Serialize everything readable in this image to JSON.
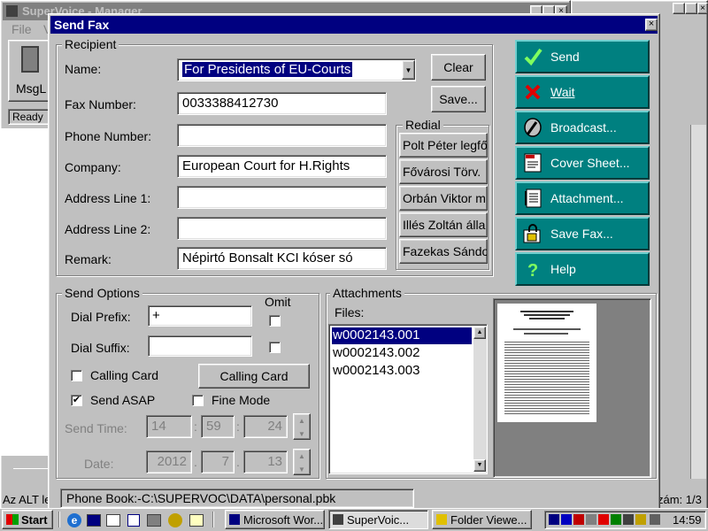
{
  "bg_window": {
    "title": "SuperVoice - Manager",
    "menu_file": "File",
    "menu_v": "V",
    "tool_label": "MsgL",
    "status_ready": "Ready",
    "status_alt": "Az ALT le",
    "page_indicator": "zám: 1/3"
  },
  "dialog": {
    "title": "Send Fax",
    "recipient_group": "Recipient",
    "labels": {
      "name": "Name:",
      "fax": "Fax Number:",
      "phone": "Phone Number:",
      "company": "Company:",
      "addr1": "Address Line 1:",
      "addr2": "Address Line 2:",
      "remark": "Remark:"
    },
    "values": {
      "name": "For Presidents of EU-Courts",
      "fax": "0033388412730",
      "phone": "",
      "company": "European Court for H.Rights",
      "addr1": "",
      "addr2": "",
      "remark": "Népirtó Bonsalt KCI kóser só"
    },
    "clear_button": "Clear",
    "save_button": "Save...",
    "redial_group": "Redial",
    "redial_items": [
      "Polt Péter legfő",
      "Fővárosi Törv.",
      "Orbán Viktor m",
      "Illés Zoltán álla",
      "Fazekas Sándo"
    ],
    "actions": [
      {
        "label": "Send",
        "icon": "check-icon"
      },
      {
        "label": "Wait",
        "icon": "x-icon"
      },
      {
        "label": "Broadcast...",
        "icon": "broadcast-icon"
      },
      {
        "label": "Cover Sheet...",
        "icon": "cover-sheet-icon"
      },
      {
        "label": "Attachment...",
        "icon": "attachment-icon"
      },
      {
        "label": "Save Fax...",
        "icon": "save-fax-icon"
      },
      {
        "label": "Help",
        "icon": "help-icon"
      }
    ],
    "send_options": {
      "group": "Send Options",
      "dial_prefix_label": "Dial Prefix:",
      "dial_prefix_value": "+",
      "dial_suffix_label": "Dial Suffix:",
      "dial_suffix_value": "",
      "omit_label": "Omit",
      "calling_card_label": "Calling Card",
      "calling_card_button": "Calling Card",
      "send_asap_label": "Send ASAP",
      "fine_mode_label": "Fine Mode",
      "send_time_label": "Send Time:",
      "time_h": "14",
      "time_m": "59",
      "time_s": "24",
      "date_label": "Date:",
      "date_y": "2012",
      "date_m": "7",
      "date_d": "13"
    },
    "attachments": {
      "group": "Attachments",
      "files_label": "Files:",
      "files": [
        "w0002143.001",
        "w0002143.002",
        "w0002143.003"
      ]
    },
    "phonebook_status": "Phone Book:-C:\\SUPERVOC\\DATA\\personal.pbk"
  },
  "taskbar": {
    "start": "Start",
    "tasks": [
      "Microsoft Wor...",
      "SuperVoic...",
      "Folder Viewe..."
    ],
    "clock": "14:59"
  },
  "colors": {
    "teal": "#008080",
    "title_blue": "#000080",
    "face": "#c0c0c0",
    "selection": "#000080"
  }
}
